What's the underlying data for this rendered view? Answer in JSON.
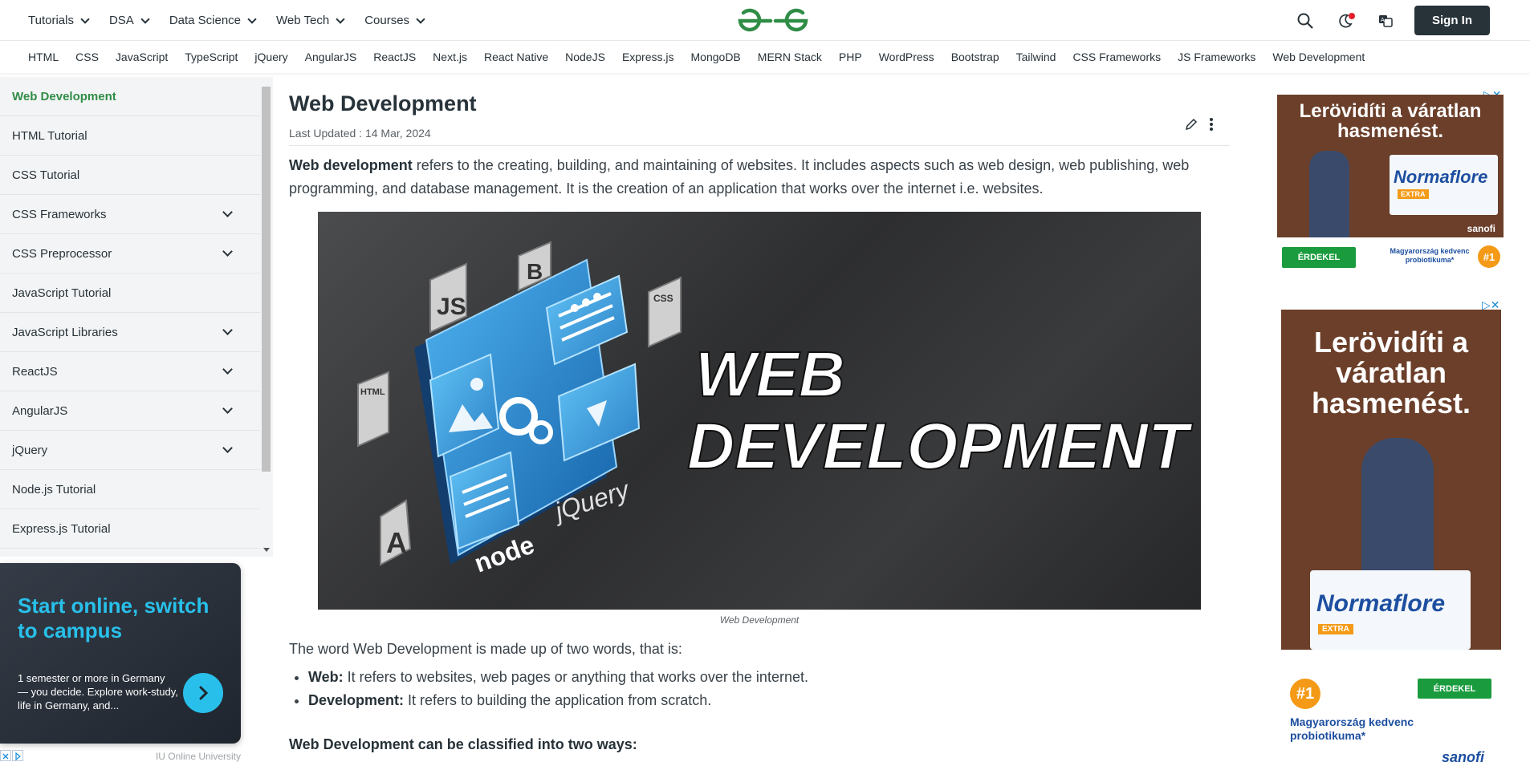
{
  "topnav": {
    "menus": [
      "Tutorials",
      "DSA",
      "Data Science",
      "Web Tech",
      "Courses"
    ],
    "signin_label": "Sign In"
  },
  "subnav": {
    "links": [
      "HTML",
      "CSS",
      "JavaScript",
      "TypeScript",
      "jQuery",
      "AngularJS",
      "ReactJS",
      "Next.js",
      "React Native",
      "NodeJS",
      "Express.js",
      "MongoDB",
      "MERN Stack",
      "PHP",
      "WordPress",
      "Bootstrap",
      "Tailwind",
      "CSS Frameworks",
      "JS Frameworks",
      "Web Development"
    ]
  },
  "sidebar": {
    "items": [
      {
        "label": "Web Development",
        "expandable": false,
        "active": true
      },
      {
        "label": "HTML Tutorial",
        "expandable": false
      },
      {
        "label": "CSS Tutorial",
        "expandable": false
      },
      {
        "label": "CSS Frameworks",
        "expandable": true
      },
      {
        "label": "CSS Preprocessor",
        "expandable": true
      },
      {
        "label": "JavaScript Tutorial",
        "expandable": false
      },
      {
        "label": "JavaScript Libraries",
        "expandable": true
      },
      {
        "label": "ReactJS",
        "expandable": true
      },
      {
        "label": "AngularJS",
        "expandable": true
      },
      {
        "label": "jQuery",
        "expandable": true
      },
      {
        "label": "Node.js Tutorial",
        "expandable": false
      },
      {
        "label": "Express.js Tutorial",
        "expandable": false
      }
    ]
  },
  "left_ad": {
    "title": "Start online, switch to campus",
    "text": "1 semester or more in Germany — you decide. Explore work-study, life in Germany, and...",
    "source": "IU Online University"
  },
  "article": {
    "title": "Web Development",
    "updated": "Last Updated : 14 Mar, 2024",
    "intro_bold": "Web development",
    "intro_rest": " refers to the creating, building, and maintaining of websites. It includes aspects such as web design, web publishing, web programming, and database management. It is the creation of an application that works over the internet i.e. websites.",
    "hero_text_1": "WEB",
    "hero_text_2": "DEVELOPMENT",
    "hero_badges": {
      "js": "JS",
      "html": "HTML",
      "css": "CSS",
      "b": "B",
      "a": "A",
      "jquery": "jQuery",
      "node": "node"
    },
    "caption": "Web Development",
    "para2": "The word Web Development is made up of two words, that is:",
    "bullets": [
      {
        "term": "Web:",
        "text": " It refers to websites, web pages or anything that works over the internet."
      },
      {
        "term": "Development:",
        "text": " It refers to building the application from scratch."
      }
    ],
    "subhead": "Web Development can be classified into two ways:"
  },
  "right_ads": {
    "headline_1": "Lerövidíti a váratlan hasmenést.",
    "brand": "Normaflore",
    "cta": "ÉRDEKEL",
    "tagline": "Magyarország kedvenc probiotikuma*",
    "rank": "#1",
    "maker": "sanofi",
    "extra": "EXTRA"
  },
  "colors": {
    "brand_green": "#2f8d46",
    "dark": "#273239",
    "ad_blue": "#28c0ea"
  }
}
